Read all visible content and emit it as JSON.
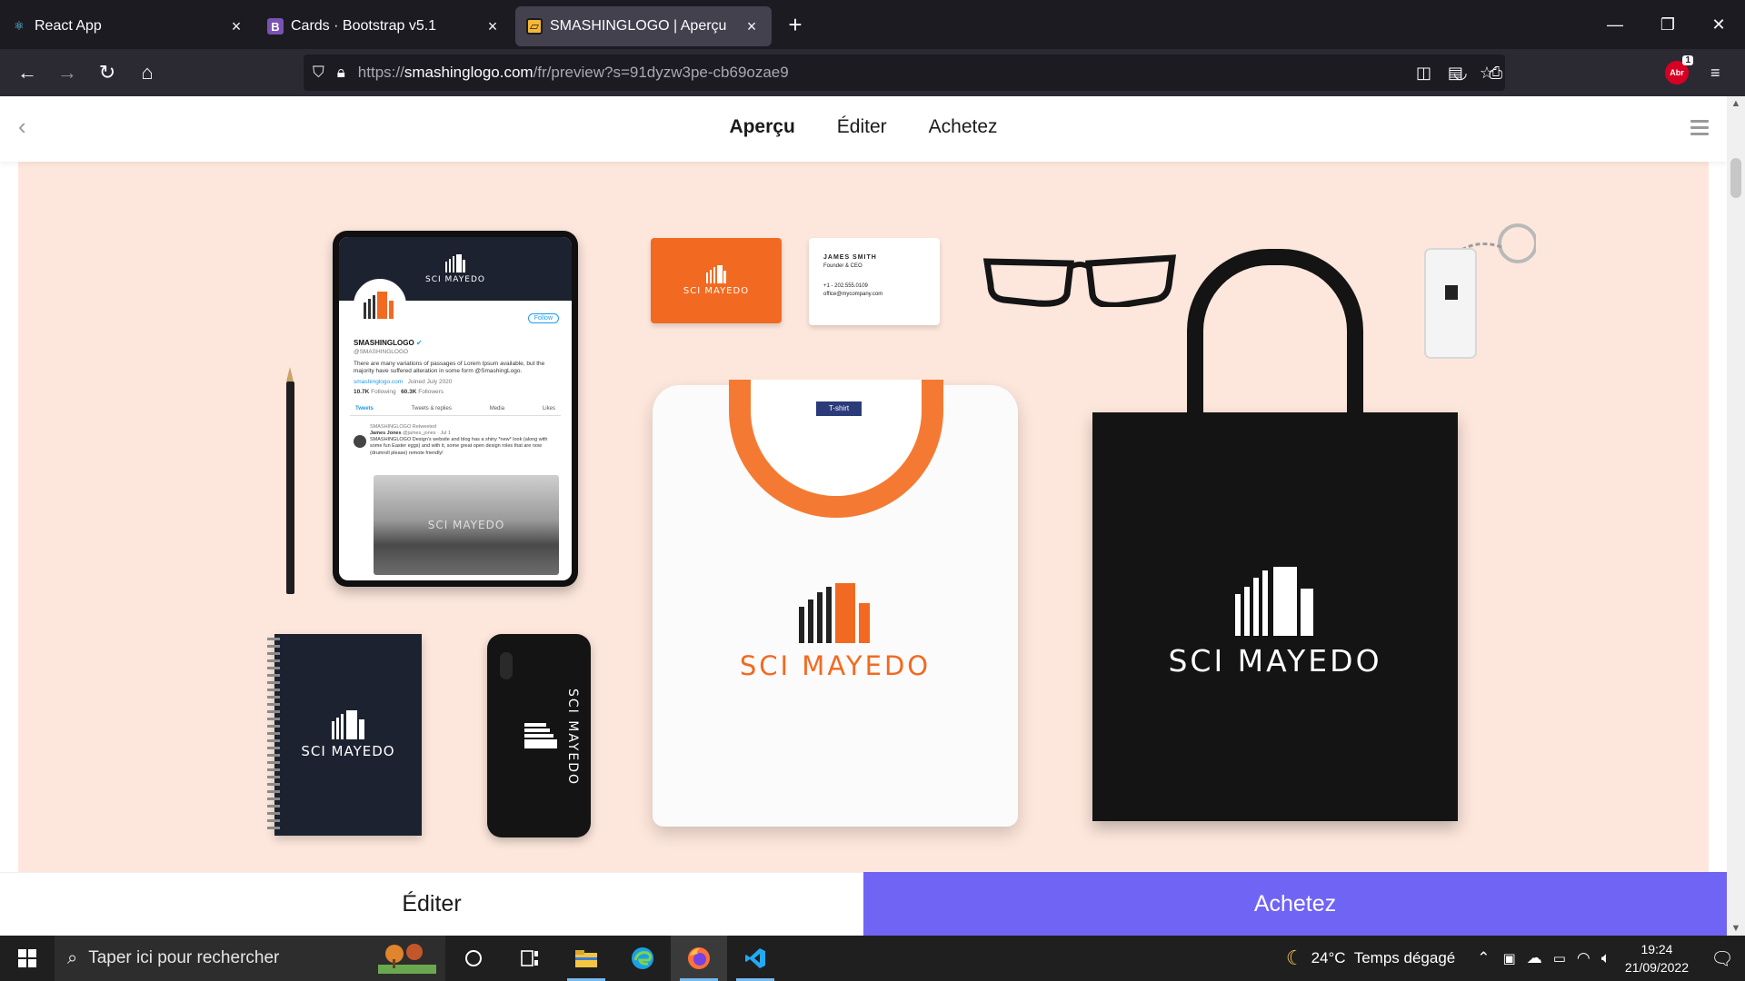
{
  "browser": {
    "tabs": [
      {
        "title": "React App",
        "icon": "react-icon"
      },
      {
        "title": "Cards · Bootstrap v5.1",
        "icon": "bootstrap-icon"
      },
      {
        "title": "SMASHINGLOGO | Aperçu",
        "icon": "smashinglogo-icon",
        "active": true
      }
    ],
    "url_prefix": "https://",
    "url_host": "smashinglogo.com",
    "url_path": "/fr/preview?s=91dyzw3pe-cb69ozae9",
    "extension_badge": "Abr",
    "extension_count": "1"
  },
  "app": {
    "nav": [
      {
        "label": "Aperçu",
        "active": true
      },
      {
        "label": "Éditer"
      },
      {
        "label": "Achetez"
      }
    ],
    "bottom_edit_label": "Éditer",
    "bottom_buy_label": "Achetez",
    "accent_color": "#7064f5",
    "preview_bg": "#fde7dc"
  },
  "mockup": {
    "brand_name": "SCI MAYEDO",
    "brand_color": "#f26a21",
    "tablet": {
      "account_name": "SMASHINGLOGO",
      "handle": "@SMASHINGLOGO",
      "follow": "Follow",
      "bio": "There are many variations of passages of Lorem Ipsum available, but the majority have suffered alteration in some form @SmashingLogo.",
      "link": "smashinglogo.com",
      "joined": "Joined July 2020",
      "following_count": "10.7K",
      "following_label": "Following",
      "followers_count": "60.3K",
      "followers_label": "Followers",
      "tabs": [
        "Tweets",
        "Tweets & replies",
        "Media",
        "Likes"
      ],
      "retweeted": "SMASHINGLOGO Retweeted",
      "tweet_author": "James Jones",
      "tweet_meta": "@james_jones · Jul 1",
      "tweet_text": "SMASHINGLOGO Design's website and blog has a shiny *new* look (along with some fun Easter eggs) and with it, some great open design roles that are now (drumroll please) remote friendly!"
    },
    "business_card": {
      "name": "JAMES SMITH",
      "title": "Founder & CEO",
      "phone": "+1 - 202.555.0109",
      "email": "office@mycompany.com"
    },
    "tshirt_tag": "T-shirt"
  },
  "taskbar": {
    "search_placeholder": "Taper ici pour rechercher",
    "weather": "24°C  Temps dégagé",
    "time": "19:24",
    "date": "21/09/2022"
  }
}
